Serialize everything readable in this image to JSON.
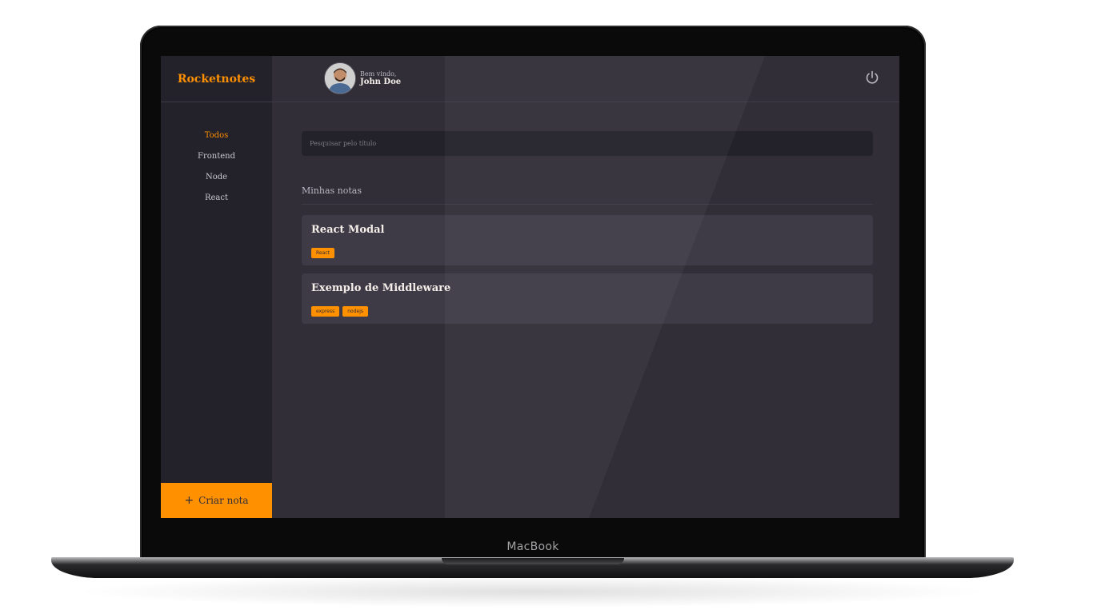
{
  "device": {
    "label": "MacBook"
  },
  "app": {
    "brand": "Rocketnotes",
    "menu": [
      {
        "label": "Todos",
        "active": true
      },
      {
        "label": "Frontend",
        "active": false
      },
      {
        "label": "Node",
        "active": false
      },
      {
        "label": "React",
        "active": false
      }
    ],
    "create_button": {
      "icon": "plus-icon",
      "label": "Criar nota"
    },
    "header": {
      "welcome": "Bem vindo,",
      "username": "John Doe",
      "avatar_icon": "user-avatar",
      "logout_icon": "power-icon"
    },
    "search": {
      "placeholder": "Pesquisar pelo título",
      "value": ""
    },
    "section_title": "Minhas notas",
    "notes": [
      {
        "title": "React Modal",
        "tags": [
          "React"
        ]
      },
      {
        "title": "Exemplo de Middleware",
        "tags": [
          "express",
          "nodejs"
        ]
      }
    ]
  },
  "colors": {
    "accent": "#ff9000",
    "background": "#312e38",
    "sidebar": "#232129",
    "card": "#3e3b47",
    "text": "#f4ede8"
  }
}
